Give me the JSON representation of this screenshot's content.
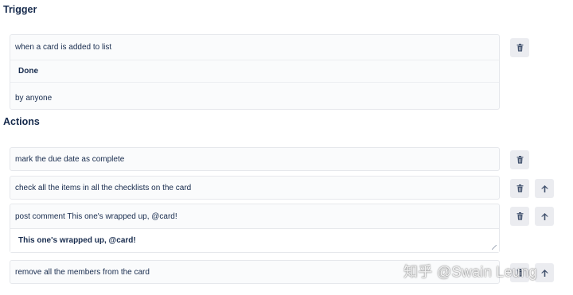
{
  "trigger": {
    "title": "Trigger",
    "line1": "when a card is added to list",
    "list_name": "Done",
    "line3": "by anyone"
  },
  "actions": {
    "title": "Actions",
    "items": [
      {
        "label": "mark the due date as complete"
      },
      {
        "label": "check all the items in all the checklists on the card"
      },
      {
        "label": "post comment This one's wrapped up, @card!",
        "comment_text": "This one's wrapped up, @card!"
      },
      {
        "label": "remove all the members from the card"
      }
    ]
  },
  "watermark": "知乎 @Swain Leung",
  "icons": {
    "delete": "trash-icon",
    "move_up": "arrow-up-icon"
  },
  "colors": {
    "text": "#172b4d",
    "button_bg": "#ebecf0",
    "card_bg": "#fafbfc"
  }
}
